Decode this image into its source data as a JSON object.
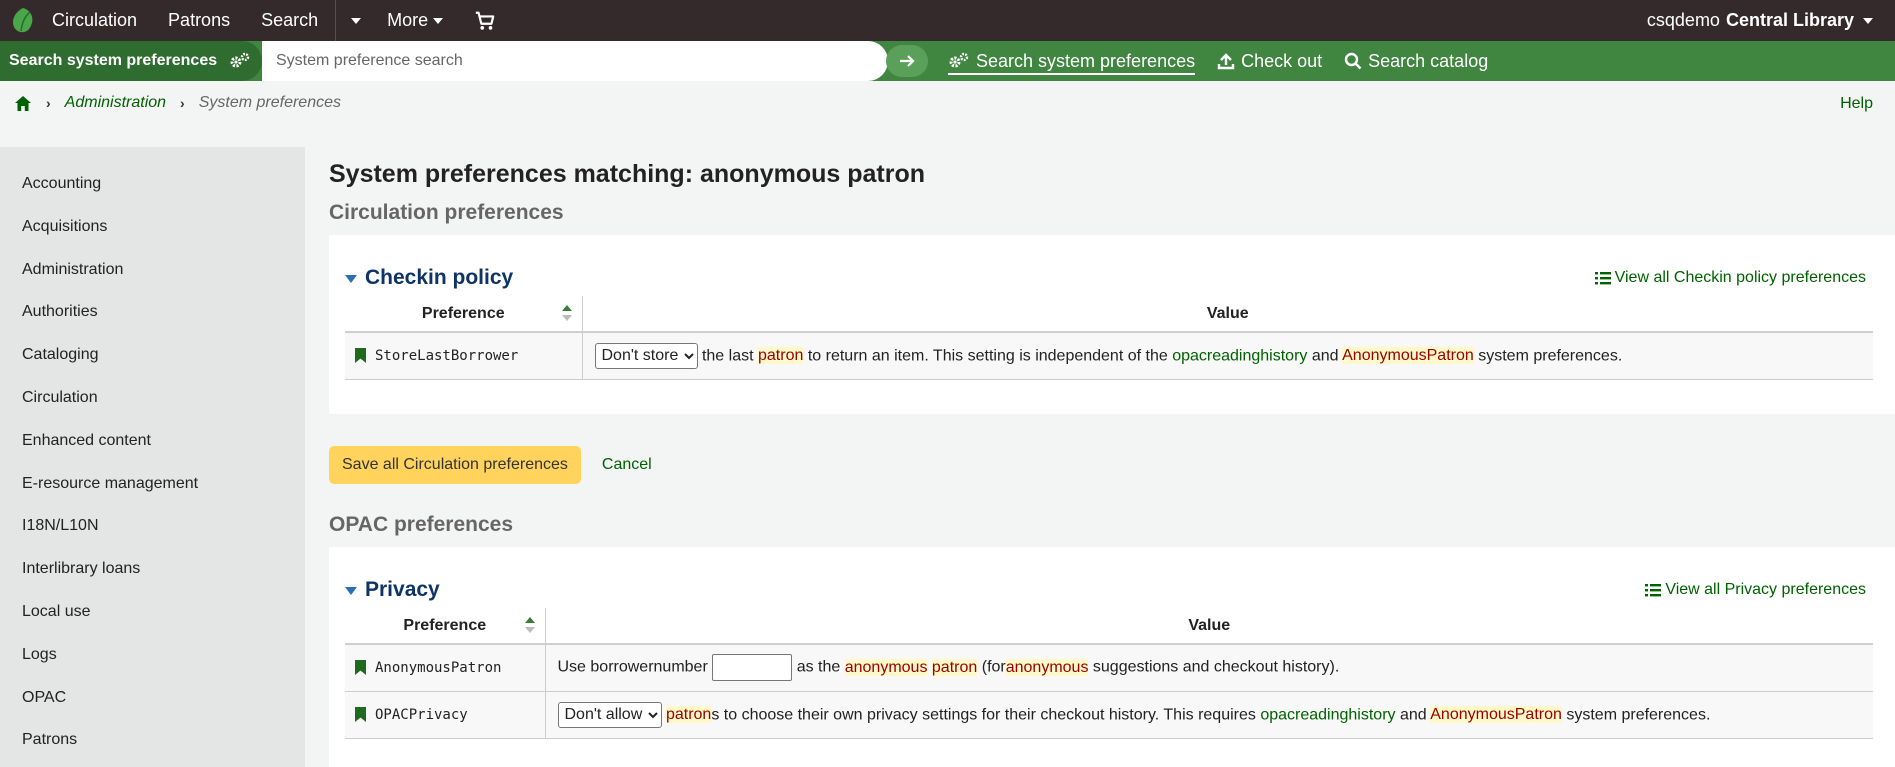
{
  "topnav": {
    "items": [
      "Circulation",
      "Patrons",
      "Search",
      "More"
    ],
    "user": "csqdemo",
    "library": "Central Library"
  },
  "searchbar": {
    "type_label": "Search system preferences",
    "placeholder": "System preference search",
    "links": [
      "Search system preferences",
      "Check out",
      "Search catalog"
    ]
  },
  "breadcrumb": {
    "parent": "Administration",
    "current": "System preferences"
  },
  "help": "Help",
  "sidebar": {
    "items": [
      "Accounting",
      "Acquisitions",
      "Administration",
      "Authorities",
      "Cataloging",
      "Circulation",
      "Enhanced content",
      "E-resource management",
      "I18N/L10N",
      "Interlibrary loans",
      "Local use",
      "Logs",
      "OPAC",
      "Patrons"
    ]
  },
  "main": {
    "title": "System preferences matching: anonymous patron",
    "circ": {
      "section_title": "Circulation preferences",
      "panel_title": "Checkin policy",
      "view_all": "View all Checkin policy preferences",
      "col_pref": "Preference",
      "col_value": "Value",
      "row": {
        "name": "StoreLastBorrower",
        "select_value": "Don't store",
        "text_a": "the last",
        "hl_patron": "patron",
        "text_b": "to return an item. This setting is independent of the",
        "link_a": "opacreadinghistory",
        "text_and": "and",
        "hl_anon": "AnonymousPatron",
        "text_end": "system preferences."
      },
      "save_label": "Save all Circulation preferences",
      "cancel_label": "Cancel"
    },
    "opac": {
      "section_title": "OPAC preferences",
      "panel_title": "Privacy",
      "view_all": "View all Privacy preferences",
      "col_pref": "Preference",
      "col_value": "Value",
      "row1": {
        "name": "AnonymousPatron",
        "text_a": "Use borrowernumber",
        "input_value": "",
        "text_b": "as the",
        "hl_anonymous": "anonymous",
        "hl_patron": "patron",
        "text_c": "(for",
        "hl_anonymous2": "anonymous",
        "text_d": "suggestions and checkout history)."
      },
      "row2": {
        "name": "OPACPrivacy",
        "select_value": "Don't allow",
        "hl_patron": "patron",
        "text_a": "s to choose their own privacy settings for their checkout history. This requires",
        "link_a": "opacreadinghistory",
        "text_and": "and",
        "hl_anon": "AnonymousPatron",
        "text_end": "system preferences."
      }
    }
  },
  "colors": {
    "topnav_bg": "#342a2c",
    "searchbar_bg": "#408540",
    "link_green": "#006100",
    "panel_title": "#0e3466",
    "save_btn": "#ffd35c",
    "highlight": "#fff8c8"
  }
}
